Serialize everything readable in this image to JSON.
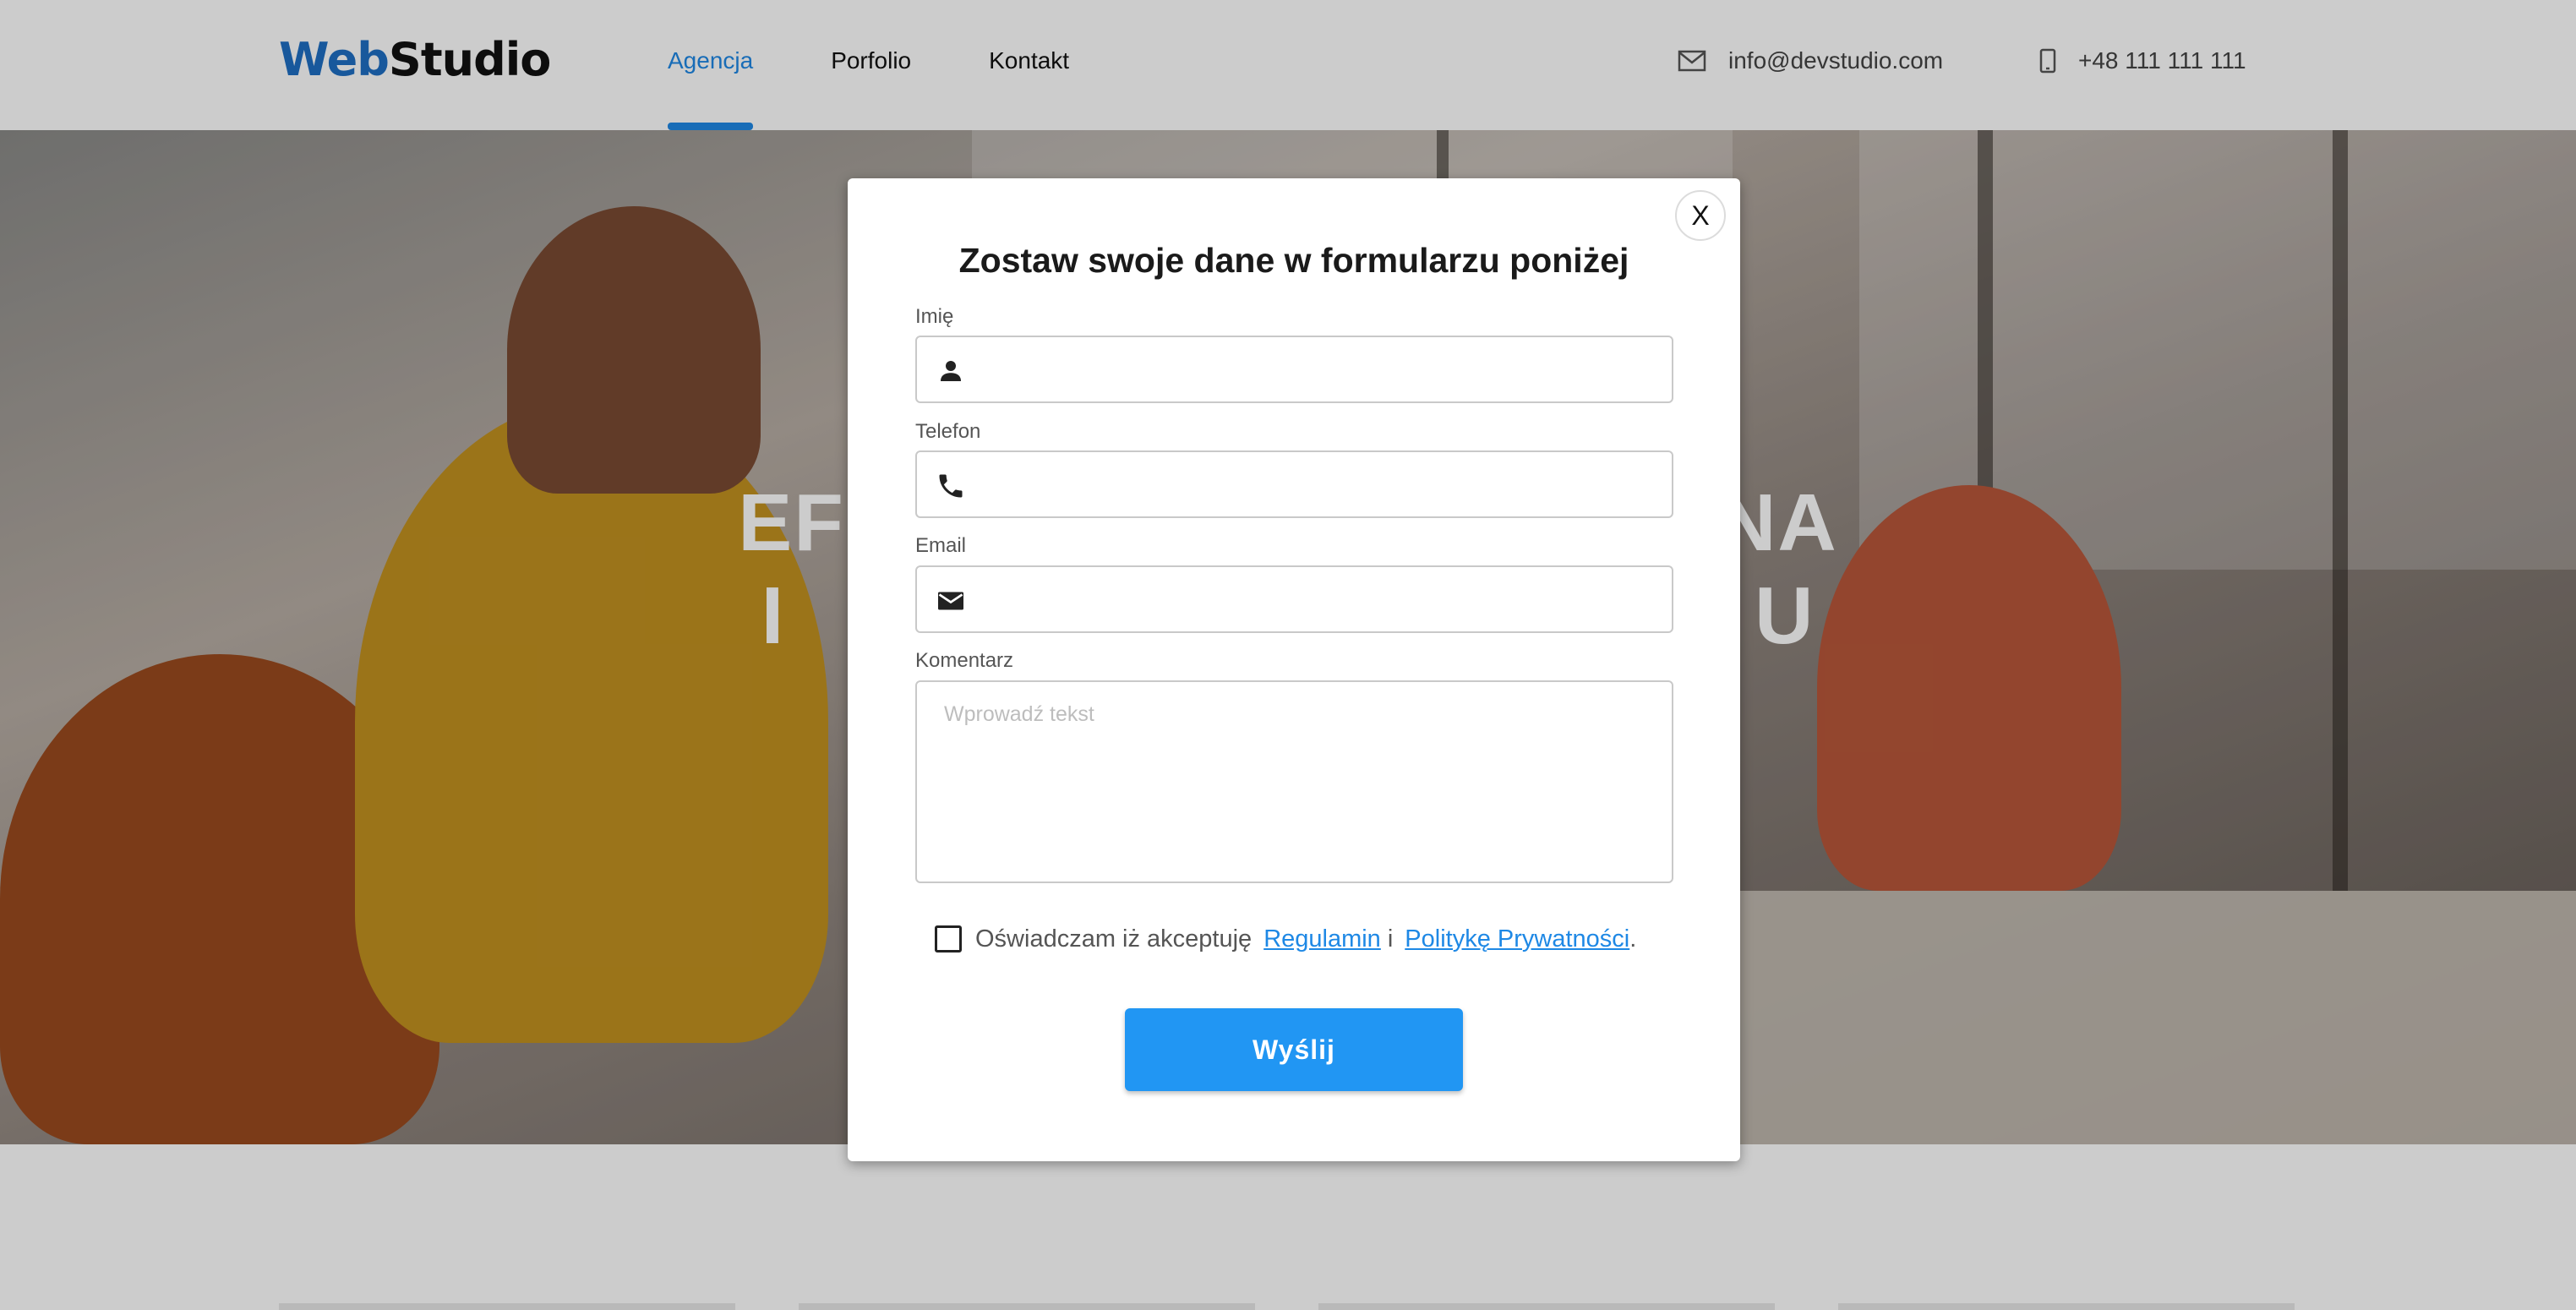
{
  "header": {
    "logo": {
      "part1": "Web",
      "part2": "Studio"
    },
    "nav": [
      {
        "label": "Agencja",
        "active": true
      },
      {
        "label": "Porfolio",
        "active": false
      },
      {
        "label": "Kontakt",
        "active": false
      }
    ],
    "email": {
      "icon": "mail-icon",
      "text": "info@devstudio.com"
    },
    "phone": {
      "icon": "mobile-phone-icon",
      "text": "+48 111 111 111"
    }
  },
  "hero": {
    "line1": "EF                                    NA",
    "line2": "I                                        U"
  },
  "modal": {
    "close_label": "X",
    "title": "Zostaw swoje dane w formularzu poniżej",
    "fields": {
      "name": {
        "label": "Imię",
        "icon": "person-icon",
        "value": ""
      },
      "phone": {
        "label": "Telefon",
        "icon": "phone-icon",
        "value": ""
      },
      "email": {
        "label": "Email",
        "icon": "envelope-icon",
        "value": ""
      },
      "comment": {
        "label": "Komentarz",
        "placeholder": "Wprowadź tekst",
        "value": ""
      }
    },
    "consent": {
      "checked": false,
      "text": "Oświadczam iż akceptuję",
      "link1": "Regulamin",
      "conj": "i",
      "link2": "Politykę Prywatności",
      "end": "."
    },
    "submit_label": "Wyślij"
  },
  "colors": {
    "accent": "#1e88e5",
    "button": "#2196f3",
    "logo_web": "#1e6fc4",
    "overlay": "rgba(0,0,0,0.2)"
  }
}
